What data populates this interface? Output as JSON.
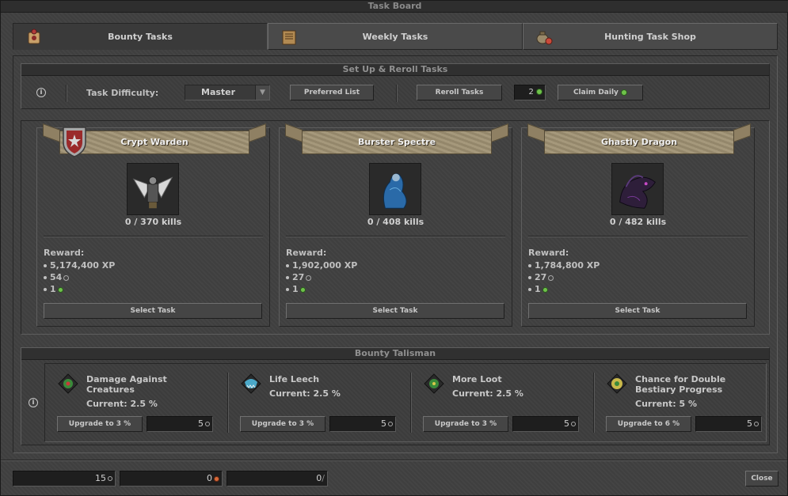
{
  "window": {
    "title": "Task Board"
  },
  "tabs": [
    {
      "label": "Bounty Tasks",
      "icon": "bounty-scroll-icon"
    },
    {
      "label": "Weekly Tasks",
      "icon": "weekly-book-icon"
    },
    {
      "label": "Hunting Task Shop",
      "icon": "shop-pouch-icon"
    }
  ],
  "setup": {
    "title": "Set Up & Reroll Tasks",
    "info": "i",
    "difficulty_label": "Task Difficulty:",
    "difficulty_value": "Master",
    "preferred_list": "Preferred List",
    "reroll": "Reroll Tasks",
    "reroll_count": "2",
    "claim_daily": "Claim Daily"
  },
  "tasks": [
    {
      "name": "Crypt Warden",
      "kills": "0 / 370 kills",
      "reward_label": "Reward:",
      "xp": "5,174,400 XP",
      "points": "54",
      "tokens": "1",
      "select": "Select Task"
    },
    {
      "name": "Burster Spectre",
      "kills": "0 / 408 kills",
      "reward_label": "Reward:",
      "xp": "1,902,000 XP",
      "points": "27",
      "tokens": "1",
      "select": "Select Task"
    },
    {
      "name": "Ghastly Dragon",
      "kills": "0 / 482 kills",
      "reward_label": "Reward:",
      "xp": "1,784,800 XP",
      "points": "27",
      "tokens": "1",
      "select": "Select Task"
    }
  ],
  "talisman": {
    "title": "Bounty Talisman",
    "info": "i",
    "items": [
      {
        "name1": "Damage Against",
        "name2": "Creatures",
        "current": "Current: 2.5 %",
        "upgrade": "Upgrade to 3 %",
        "cost": "5",
        "icon": "damage-talisman-icon"
      },
      {
        "name1": "Life Leech",
        "name2": "",
        "current": "Current: 2.5 %",
        "upgrade": "Upgrade to 3 %",
        "cost": "5",
        "icon": "leech-talisman-icon"
      },
      {
        "name1": "More Loot",
        "name2": "",
        "current": "Current: 2.5 %",
        "upgrade": "Upgrade to 3 %",
        "cost": "5",
        "icon": "loot-talisman-icon"
      },
      {
        "name1": "Chance for Double",
        "name2": "Bestiary Progress",
        "current": "Current: 5 %",
        "upgrade": "Upgrade to 6 %",
        "cost": "5",
        "icon": "bestiary-talisman-icon"
      }
    ]
  },
  "footer": {
    "points": "15",
    "shop_points": "0",
    "other": "0",
    "close": "Close"
  },
  "colors": {
    "banner": "#a09274",
    "background": "#404040",
    "token_green": "#6fc24a"
  }
}
